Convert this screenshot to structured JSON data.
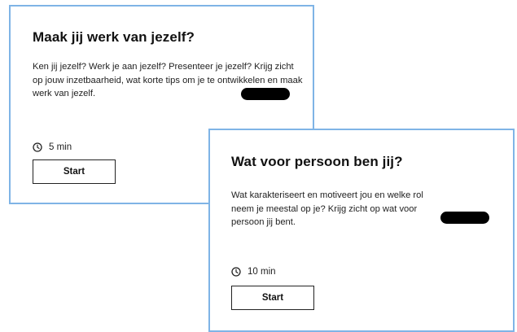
{
  "cards": [
    {
      "title": "Maak jij werk van jezelf?",
      "description": "Ken jij jezelf? Werk je aan jezelf? Presenteer je jezelf? Krijg zicht op jouw inzetbaarheid, wat korte tips om je te ontwikkelen en maak werk van jezelf.",
      "duration": "5 min",
      "start_label": "Start",
      "duration_icon": "clock-icon"
    },
    {
      "title": "Wat voor persoon ben jij?",
      "description": "Wat karakteriseert en motiveert jou en welke rol neem je meestal op je? Krijg zicht op wat voor persoon jij bent.",
      "duration": "10 min",
      "start_label": "Start",
      "duration_icon": "clock-icon"
    }
  ],
  "colors": {
    "card_border": "#7fb4e6",
    "badge": "#000000",
    "text": "#1a1a1a"
  }
}
